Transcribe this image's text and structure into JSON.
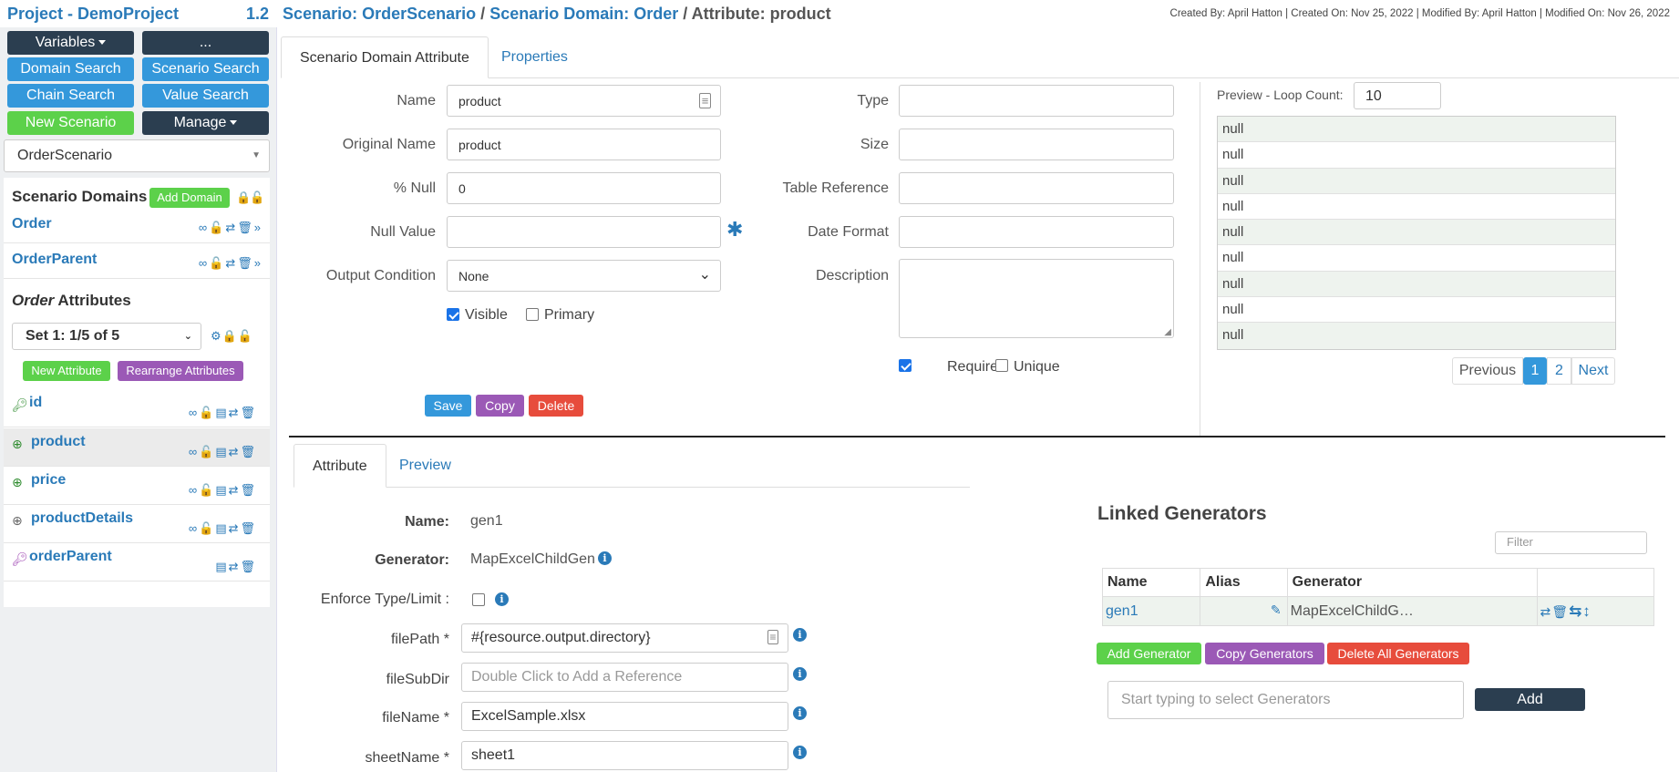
{
  "header": {
    "project": "Project - DemoProject",
    "version": "1.2",
    "crumb_scenario": "Scenario: OrderScenario",
    "sep": "/",
    "crumb_domain": "Scenario Domain: Order",
    "crumb_attr": "Attribute: product",
    "meta": "Created By: April Hatton | Created On: Nov 25, 2022 | Modified By: April Hatton | Modified On: Nov 26, 2022"
  },
  "sidebar": {
    "buttons": {
      "variables": "Variables",
      "more": "...",
      "domain_search": "Domain Search",
      "scenario_search": "Scenario Search",
      "chain_search": "Chain Search",
      "value_search": "Value Search",
      "new_scenario": "New Scenario",
      "manage": "Manage"
    },
    "scenario_select": "OrderScenario",
    "domains_title": "Scenario Domains",
    "add_domain": "Add Domain",
    "domains": [
      {
        "name": "Order"
      },
      {
        "name": "OrderParent"
      }
    ],
    "attrs_title_em": "Order",
    "attrs_title_rest": " Attributes",
    "set_select": "Set 1: 1/5 of 5",
    "new_attribute": "New Attribute",
    "rearrange": "Rearrange Attributes",
    "attributes": [
      {
        "name": "id",
        "icon": "key-icon"
      },
      {
        "name": "product",
        "icon": "lifebuoy-icon"
      },
      {
        "name": "price",
        "icon": "lifebuoy-icon"
      },
      {
        "name": "productDetails",
        "icon": "lifebuoy-icon"
      },
      {
        "name": "orderParent",
        "icon": "key-icon"
      }
    ]
  },
  "main": {
    "tabs": [
      "Scenario Domain Attribute",
      "Properties"
    ],
    "form": {
      "name_label": "Name",
      "name_value": "product",
      "orig_label": "Original Name",
      "orig_value": "product",
      "null_label": "% Null",
      "null_value": "0",
      "nullval_label": "Null Value",
      "nullval_value": "",
      "output_label": "Output Condition",
      "output_value": "None",
      "visible_label": "Visible",
      "primary_label": "Primary",
      "type_label": "Type",
      "size_label": "Size",
      "tableref_label": "Table Reference",
      "date_label": "Date Format",
      "desc_label": "Description",
      "required_label": "Required",
      "unique_label": "Unique",
      "save": "Save",
      "copy": "Copy",
      "delete": "Delete"
    },
    "preview": {
      "label": "Preview - Loop Count:",
      "loop_count": "10",
      "rows": [
        "null",
        "null",
        "null",
        "null",
        "null",
        "null",
        "null",
        "null",
        "null"
      ],
      "pager": {
        "previous": "Previous",
        "p1": "1",
        "p2": "2",
        "next": "Next"
      }
    },
    "bottom_tabs": [
      "Attribute",
      "Preview"
    ],
    "generator": {
      "name_label": "Name:",
      "name_value": "gen1",
      "gen_label": "Generator:",
      "gen_value": "MapExcelChildGen",
      "enforce_label": "Enforce Type/Limit :",
      "filepath_label": "filePath *",
      "filepath_value": "#{resource.output.directory}",
      "filesubdir_label": "fileSubDir",
      "filesubdir_placeholder": "Double Click to Add a Reference",
      "filename_label": "fileName *",
      "filename_value": "ExcelSample.xlsx",
      "sheetname_label": "sheetName *",
      "sheetname_value": "sheet1"
    },
    "linked": {
      "title": "Linked Generators",
      "filter_placeholder": "Filter",
      "columns": [
        "Name",
        "Alias",
        "Generator"
      ],
      "rows": [
        {
          "name": "gen1",
          "alias": "",
          "generator": "MapExcelChildG…"
        }
      ],
      "add_generator": "Add Generator",
      "copy_generators": "Copy Generators",
      "delete_all": "Delete All Generators",
      "select_placeholder": "Start typing to select Generators",
      "add": "Add"
    }
  }
}
